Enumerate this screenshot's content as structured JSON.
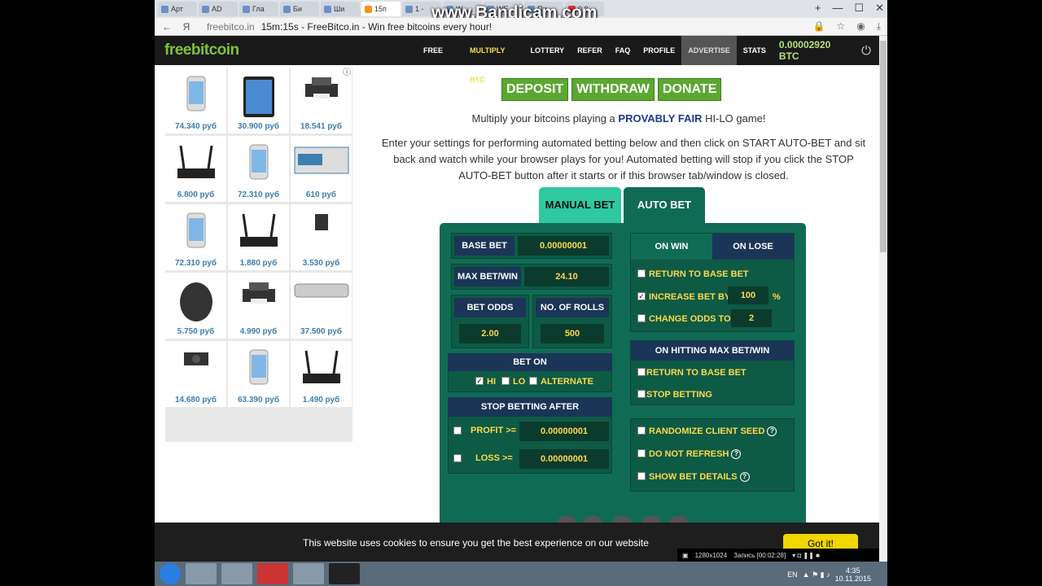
{
  "browser": {
    "tabs": [
      "Арт",
      "AD",
      "Гла",
      "Би",
      "Ши",
      "15п",
      "1 -",
      "W",
      "WE",
      "Пи",
      "0.0"
    ],
    "watermark": "www.Bandicam.com",
    "address_host": "freebitco.in",
    "page_title": "15m:15s - FreeBitco.in - Win free bitcoins every hour!",
    "back_label": "←",
    "yandex_label": "Я"
  },
  "site": {
    "logo": "freebitcoin",
    "menu": [
      "FREE BTC",
      "MULTIPLY BTC",
      "LOTTERY",
      "REFER",
      "FAQ",
      "PROFILE",
      "ADVERTISE",
      "STATS"
    ],
    "balance": "0.00002920 BTC"
  },
  "ads": [
    {
      "price": "74.340 руб",
      "icon": "smartphone-icon"
    },
    {
      "price": "30.900 руб",
      "icon": "tablet-icon"
    },
    {
      "price": "18.541 руб",
      "icon": "printer-icon"
    },
    {
      "price": "6.800 руб",
      "icon": "router-icon"
    },
    {
      "price": "72.310 руб",
      "icon": "smartphone-icon"
    },
    {
      "price": "610 руб",
      "icon": "toner-icon"
    },
    {
      "price": "72.310 руб",
      "icon": "smartphone-icon"
    },
    {
      "price": "1.880 руб",
      "icon": "router-icon"
    },
    {
      "price": "3.530 руб",
      "icon": "hdd-icon"
    },
    {
      "price": "5.750 руб",
      "icon": "mouse-icon"
    },
    {
      "price": "4.990 руб",
      "icon": "printer-icon"
    },
    {
      "price": "37.500 руб",
      "icon": "minipc-icon"
    },
    {
      "price": "14.680 руб",
      "icon": "graphics-card-icon"
    },
    {
      "price": "63.390 руб",
      "icon": "smartphone-icon"
    },
    {
      "price": "1.490 руб",
      "icon": "router-icon"
    }
  ],
  "buttons": {
    "deposit": "DEPOSIT",
    "withdraw": "WITHDRAW",
    "donate": "DONATE"
  },
  "intro": {
    "pre": "Multiply your bitcoins playing a ",
    "strong": "PROVABLY FAIR",
    "post": " HI-LO game!",
    "description": "Enter your settings for performing automated betting below and then click on START AUTO-BET and sit back and watch while your browser plays for you! Automated betting will stop if you click the STOP AUTO-BET button after it starts or if this browser tab/window is closed."
  },
  "bet_tabs": {
    "manual": "MANUAL BET",
    "auto": "AUTO BET"
  },
  "auto_bet": {
    "base_bet_label": "BASE BET",
    "base_bet": "0.00000001",
    "max_bet_label": "MAX BET/WIN",
    "max_bet": "24.10",
    "bet_odds_label": "BET ODDS",
    "bet_odds": "2.00",
    "rolls_label": "NO. OF ROLLS",
    "rolls": "500",
    "bet_on_label": "BET ON",
    "hi": "HI",
    "lo": "LO",
    "alternate": "ALTERNATE",
    "stop_label": "STOP BETTING AFTER",
    "profit_label": "PROFIT >=",
    "profit": "0.00000001",
    "loss_label": "LOSS >=",
    "loss": "0.00000001",
    "on_win": "ON WIN",
    "on_lose": "ON LOSE",
    "return_base": "RETURN TO BASE BET",
    "increase_by": "INCREASE BET BY",
    "increase_value": "100",
    "percent": "%",
    "change_odds": "CHANGE ODDS TO",
    "change_odds_value": "2",
    "max_hit_label": "ON HITTING MAX BET/WIN",
    "max_return": "RETURN TO BASE BET",
    "max_stop": "STOP BETTING",
    "randomize": "RANDOMIZE CLIENT SEED",
    "no_refresh": "DO NOT REFRESH",
    "show_details": "SHOW BET DETAILS",
    "help": "?"
  },
  "cookie": {
    "text": "This website uses cookies to ensure you get the best experience on our website",
    "button": "Got it!"
  },
  "recorder": {
    "resolution": "1280x1024",
    "recording": "Запись [00:02:28]"
  },
  "taskbar": {
    "lang": "EN",
    "time": "4:35",
    "date": "10.11.2015"
  }
}
